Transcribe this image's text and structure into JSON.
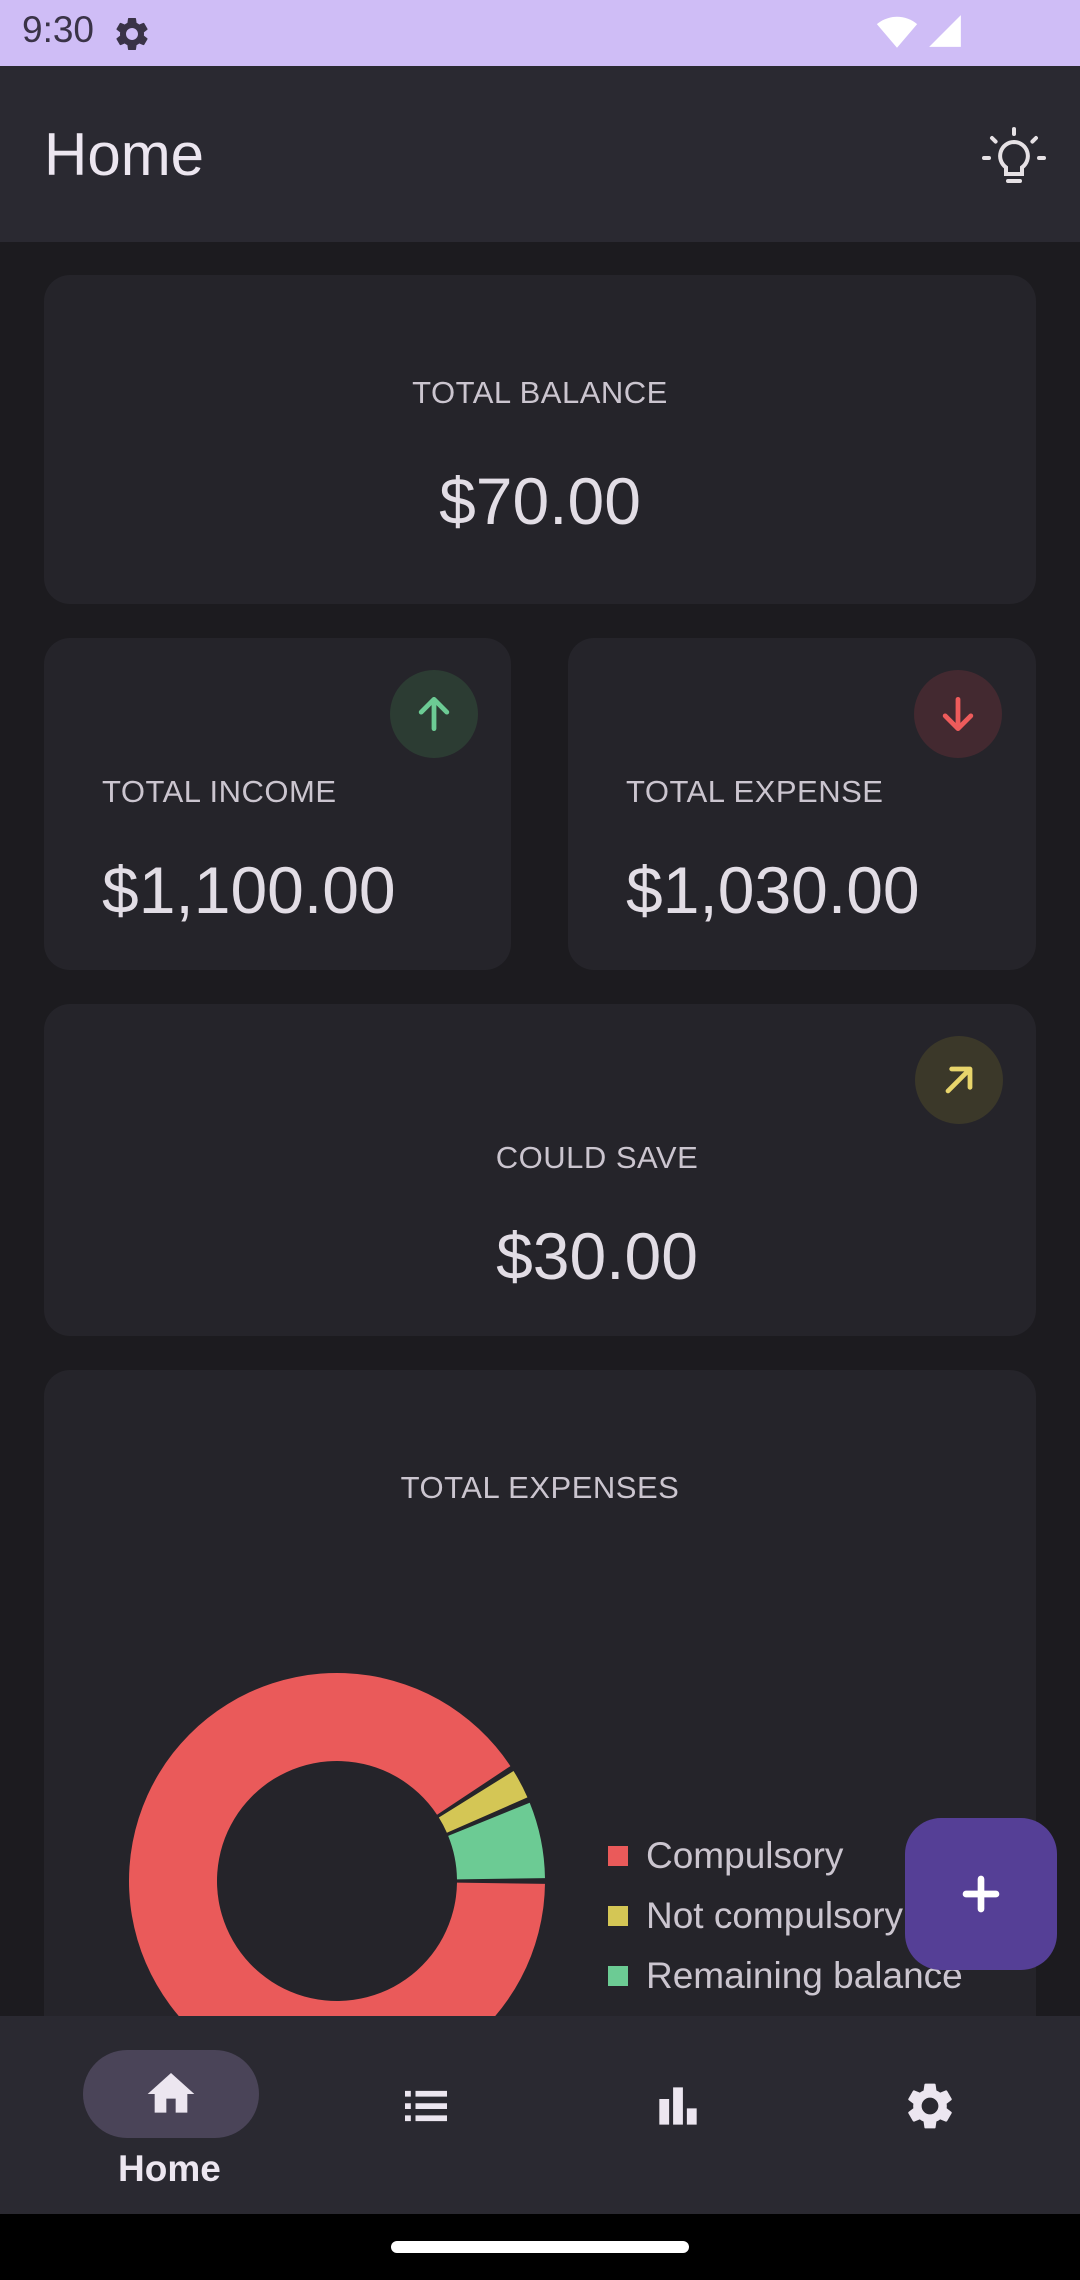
{
  "status_bar": {
    "time": "9:30"
  },
  "app_bar": {
    "title": "Home",
    "action_icon": "lightbulb-icon"
  },
  "balance_card": {
    "label": "TOTAL BALANCE",
    "value": "$70.00"
  },
  "income_card": {
    "label": "TOTAL INCOME",
    "value": "$1,100.00",
    "icon": "arrow-up-icon",
    "accent": "#6ccb94"
  },
  "expense_card": {
    "label": "TOTAL EXPENSE",
    "value": "$1,030.00",
    "icon": "arrow-down-icon",
    "accent": "#ee5b5b"
  },
  "save_card": {
    "label": "COULD SAVE",
    "value": "$30.00",
    "icon": "arrow-up-right-icon",
    "accent": "#e8d56b"
  },
  "expenses_chart_card": {
    "title": "TOTAL EXPENSES"
  },
  "chart_data": {
    "type": "pie",
    "donut": true,
    "categories": [
      "Compulsory",
      "Not compulsory",
      "Remaining balance"
    ],
    "values": [
      1000,
      30,
      70
    ],
    "colors": [
      "#ea5a5a",
      "#d4c655",
      "#6ccb94"
    ],
    "legend_position": "right"
  },
  "fab": {
    "icon": "plus-icon"
  },
  "bottom_nav": {
    "items": [
      {
        "icon": "home-icon",
        "label": "Home",
        "selected": true
      },
      {
        "icon": "list-icon",
        "label": "",
        "selected": false
      },
      {
        "icon": "bar-chart-icon",
        "label": "",
        "selected": false
      },
      {
        "icon": "gear-icon",
        "label": "",
        "selected": false
      }
    ]
  }
}
